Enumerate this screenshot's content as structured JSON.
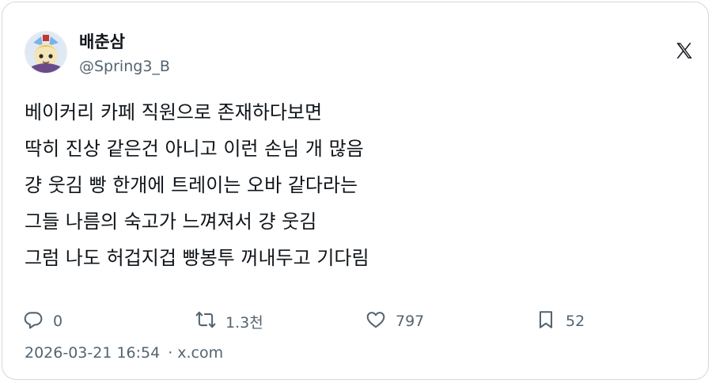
{
  "author": {
    "name": "배춘삼",
    "handle": "@Spring3_B",
    "avatar_icon": "avatar-character-icon"
  },
  "platform_icon": "x-logo-icon",
  "post": {
    "lines": [
      "베이커리 카페 직원으로 존재하다보면",
      "딱히 진상 같은건 아니고 이런 손님 개 많음",
      "걍 웃김 빵 한개에 트레이는 오바 같다라는",
      "그들 나름의 숙고가 느껴져서 걍 웃김",
      "그럼 나도 허겁지겁 빵봉투 꺼내두고 기다림"
    ]
  },
  "stats": {
    "replies": "0",
    "reposts": "1.3천",
    "likes": "797",
    "bookmarks": "52"
  },
  "meta": {
    "timestamp": "2026-03-21 16:54",
    "separator": "·",
    "source": "x.com"
  },
  "colors": {
    "text": "#0f1419",
    "secondary": "#536471",
    "border": "#cfd9de"
  }
}
